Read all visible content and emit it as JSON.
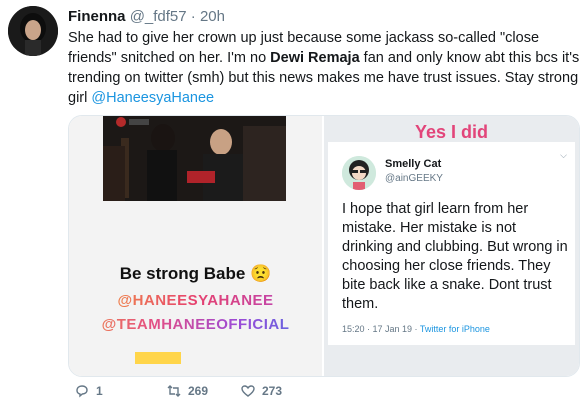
{
  "tweet": {
    "name": "Finenna",
    "handle": "@_fdf57",
    "dot": "·",
    "time": "20h",
    "text_1": "She had to give her crown up just because some jackass so-called \"close friends\" snitched on her. I'm no ",
    "text_bold": "Dewi Remaja",
    "text_2": " fan and only know abt this bcs it's trending on twitter (smh) but this news makes me have trust issues. Stay strong girl ",
    "text_mention": "@HaneesyaHanee"
  },
  "media_left": {
    "strong_text": "Be strong Babe",
    "emoji": "😟",
    "tag_1": "@HANEESYAHANEE",
    "tag_2": "@TEAMHANEEOFFICIAL"
  },
  "media_right": {
    "heading": "Yes I did",
    "quote": {
      "name": "Smelly Cat",
      "handle": "@ainGEEKY",
      "text": "I hope that girl learn from her mistake. Her mistake is not drinking and clubbing. But wrong in choosing her close friends. They bite back like a snake. Dont trust them.",
      "timestamp": "15:20 · 17 Jan 19 · ",
      "source": "Twitter for iPhone"
    }
  },
  "actions": {
    "reply_count": "1",
    "retweet_count": "269",
    "like_count": "273"
  },
  "colors": {
    "link": "#1b95e0",
    "muted": "#657786",
    "heading_pink": "#e2457a"
  }
}
